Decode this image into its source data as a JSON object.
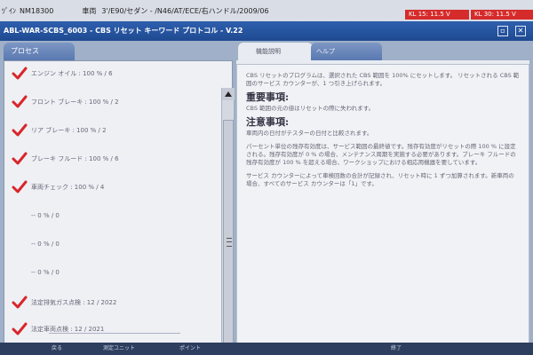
{
  "topbar": {
    "vin_label": "ﾂﾞｲﾝ",
    "vin": "NM18300",
    "vehicle_label": "車両",
    "vehicle": "3'/E90/セダン - /N46/AT/ECE/右ハンドル/2009/06",
    "kl15": "KL 15: 11.5 V",
    "kl30": "KL 30: 11.5 V"
  },
  "window": {
    "title": "ABL-WAR-SCBS_6003 - CBS リセット キーワード プロトコル - V.22",
    "minimize_icon": "window-icon",
    "close_icon": "close-icon"
  },
  "tabs": {
    "process": "プロセス",
    "function": "機能説明",
    "help": "ヘルプ"
  },
  "items": [
    {
      "label": "エンジン オイル : 100 % / 6",
      "checked": true
    },
    {
      "label": "フロント ブレーキ : 100 % / 2",
      "checked": true
    },
    {
      "label": "リア ブレーキ : 100 % / 2",
      "checked": true
    },
    {
      "label": "ブレーキ フルード : 100 % / 6",
      "checked": true
    },
    {
      "label": "車両チェック : 100 % / 4",
      "checked": true
    },
    {
      "label": "-- 0 % / 0",
      "checked": false
    },
    {
      "label": "-- 0 % / 0",
      "checked": false
    },
    {
      "label": "-- 0 % / 0",
      "checked": false
    },
    {
      "label": "法定排気ガス点検 : 12 / 2022",
      "checked": true
    },
    {
      "label": "法定車両点検 : 12 / 2021",
      "checked": true
    }
  ],
  "description": {
    "intro": "CBS リセットのプログラムは、選択された CBS 範囲を 100% にセットします。 リセットされる CBS 範囲のサービス カウンターが、1 つ引き上げられます。",
    "important_heading": "重要事項:",
    "important_text": "CBS 範囲の元の値はリセットの際に失われます。",
    "notice_heading": "注意事項:",
    "notice_text_1": "車両内の日付がテスターの日付と比較されます。",
    "notice_text_2": "パーセント単位の残存有効度は、サービス範囲の最終値です。残存有効度がリセットの際 100 % に設定される。残存有効度が 0 % の場合、メンテナンス周期を実施する必要があります。ブレーキ フルードの残存有効度が 100 % を超える場合、ワークショップにおける相応用機器を要しています。",
    "notice_text_3": "サービス カウンターによって車検回数の合計が記録され、リセット時に 1 ずつ加算されます。新車両の場合、すべてのサービス カウンターは「1」です。"
  },
  "bottombar": {
    "left": "戻る",
    "mid1": "測定ユニット",
    "mid2": "ポイント",
    "right": "終了"
  },
  "colors": {
    "check": "#d8262a",
    "title_bar": "#2e5fae",
    "alert": "#d62b2b"
  }
}
